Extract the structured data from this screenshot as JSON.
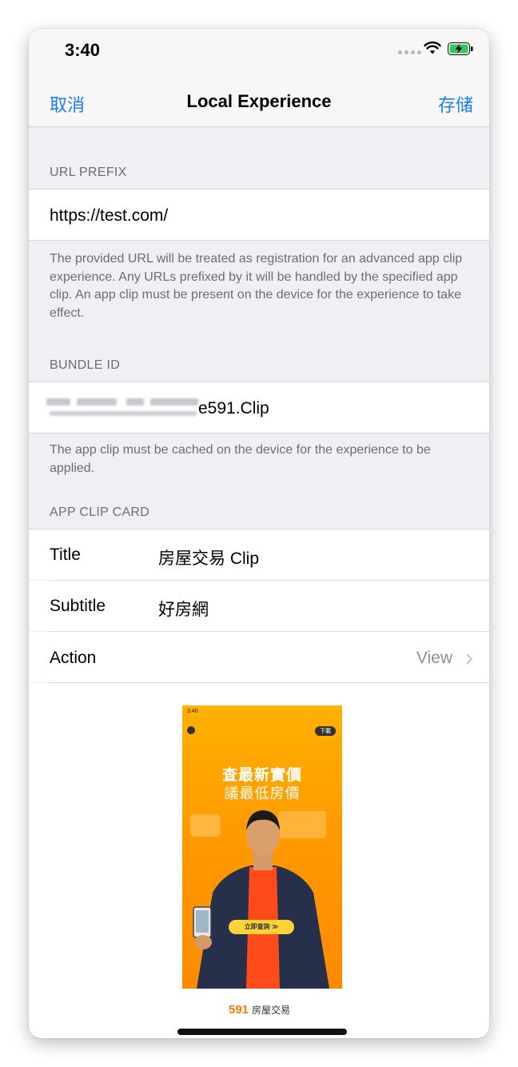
{
  "status_bar": {
    "time": "3:40"
  },
  "nav": {
    "cancel": "取消",
    "title": "Local Experience",
    "save": "存储"
  },
  "url_prefix": {
    "header": "URL PREFIX",
    "value": "https://test.com/",
    "footer": "The provided URL will be treated as registration for an advanced app clip experience. Any URLs prefixed by it will be handled by the specified app clip. An app clip must be present on the device for the experience to take effect."
  },
  "bundle_id": {
    "header": "BUNDLE ID",
    "value_suffix": "e591.Clip",
    "footer": "The app clip must be cached on the device for the experience to be applied."
  },
  "app_clip_card": {
    "header": "APP CLIP CARD",
    "title_label": "Title",
    "title_value": "房屋交易 Clip",
    "subtitle_label": "Subtitle",
    "subtitle_value": "好房網",
    "action_label": "Action",
    "action_value": "View"
  },
  "card_preview": {
    "status_time": "3:40",
    "button": "下載",
    "headline1": "查最新實價",
    "headline2": "議最低房價",
    "cta": "立即查詢 ≫",
    "logo_number": "591",
    "logo_text": "房屋交易"
  },
  "colors": {
    "accent": "#1a7cf6",
    "brand_orange": "#ff8a00"
  }
}
